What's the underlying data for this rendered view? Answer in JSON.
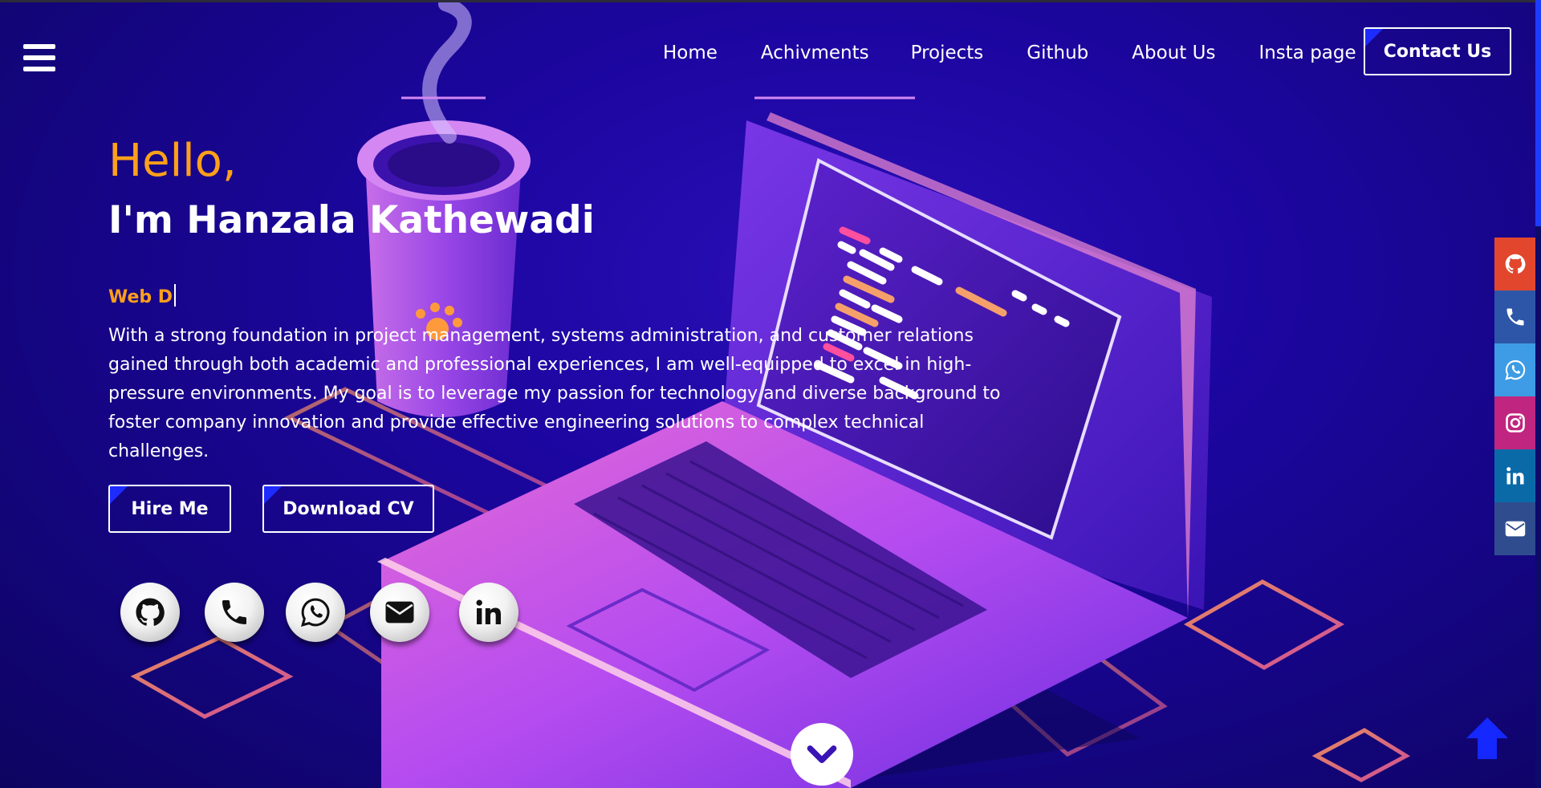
{
  "nav": {
    "items": [
      {
        "label": "Home"
      },
      {
        "label": "Achivments"
      },
      {
        "label": "Projects"
      },
      {
        "label": "Github"
      },
      {
        "label": "About Us"
      },
      {
        "label": "Insta page"
      }
    ],
    "contact_label": "Contact Us"
  },
  "hero": {
    "greeting": "Hello,",
    "name": "I'm Hanzala Kathewadi",
    "typed_role": "Web D",
    "bio": "With a strong foundation in project management, systems administration, and customer relations gained through both academic and professional experiences, I am well-equipped to excel in high-pressure environments. My goal is to leverage my passion for technology and diverse background to foster company innovation and provide effective engineering solutions to complex technical challenges.",
    "hire_label": "Hire Me",
    "cv_label": "Download CV"
  },
  "social_circles": [
    {
      "icon": "github-icon"
    },
    {
      "icon": "phone-icon"
    },
    {
      "icon": "whatsapp-icon"
    },
    {
      "icon": "envelope-icon"
    },
    {
      "icon": "linkedin-icon"
    }
  ],
  "side_rail": [
    {
      "icon": "github-icon",
      "color": "#e2472e"
    },
    {
      "icon": "phone-icon",
      "color": "#2e56a8"
    },
    {
      "icon": "whatsapp-icon",
      "color": "#3d9ce5"
    },
    {
      "icon": "instagram-icon",
      "color": "#c0267f"
    },
    {
      "icon": "linkedin-icon",
      "color": "#0a6aa8"
    },
    {
      "icon": "envelope-icon",
      "color": "#2f4c8e"
    }
  ],
  "colors": {
    "accent_orange": "#ff9f1a",
    "background": "#1c06a0",
    "button_corner": "#1e2bff",
    "back_to_top": "#1428ff"
  }
}
